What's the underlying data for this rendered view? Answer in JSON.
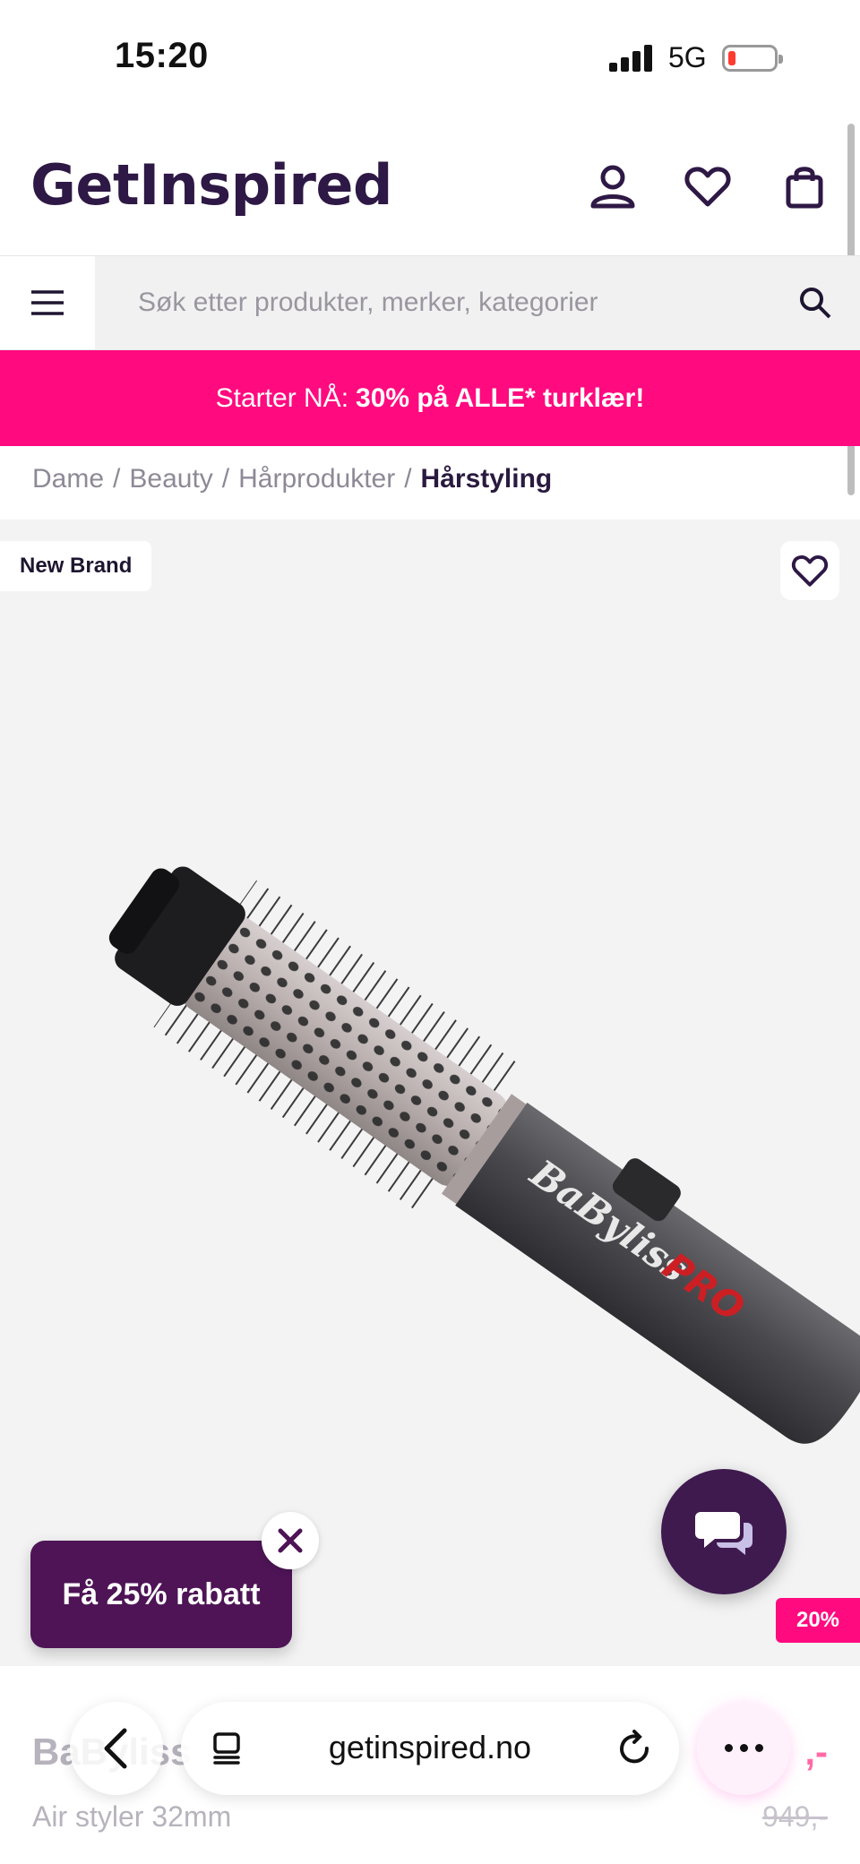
{
  "status_bar": {
    "time": "15:20",
    "network": "5G"
  },
  "header": {
    "logo": "GetInspired"
  },
  "search": {
    "placeholder": "Søk etter produkter, merker, kategorier"
  },
  "promo": {
    "prefix": "Starter NÅ:",
    "highlight": "30% på ALLE* turklær!"
  },
  "breadcrumb": {
    "items": [
      "Dame",
      "Beauty",
      "Hårprodukter"
    ],
    "current": "Hårstyling",
    "separator": "/"
  },
  "product": {
    "badge": "New Brand",
    "image_brand_text": "BaByliss",
    "image_brand_pro": "PRO",
    "discount": "20%",
    "name": "BaByliss",
    "subtitle": "Air styler 32mm",
    "price_now": ",-",
    "price_old": "949,-"
  },
  "popup": {
    "rabatt_label": "Få 25% rabatt"
  },
  "browser": {
    "url": "getinspired.no"
  },
  "colors": {
    "brand": "#2e1845",
    "accent_pink": "#ff0a7f",
    "rabatt_bg": "#4e1456",
    "chat_bg": "#3e1a4f"
  },
  "icons": [
    "signal-icon",
    "battery-icon",
    "account-icon",
    "heart-icon",
    "bag-icon",
    "menu-icon",
    "search-icon",
    "close-icon",
    "chat-icon",
    "back-icon",
    "tabs-icon",
    "reload-icon",
    "more-icon"
  ]
}
